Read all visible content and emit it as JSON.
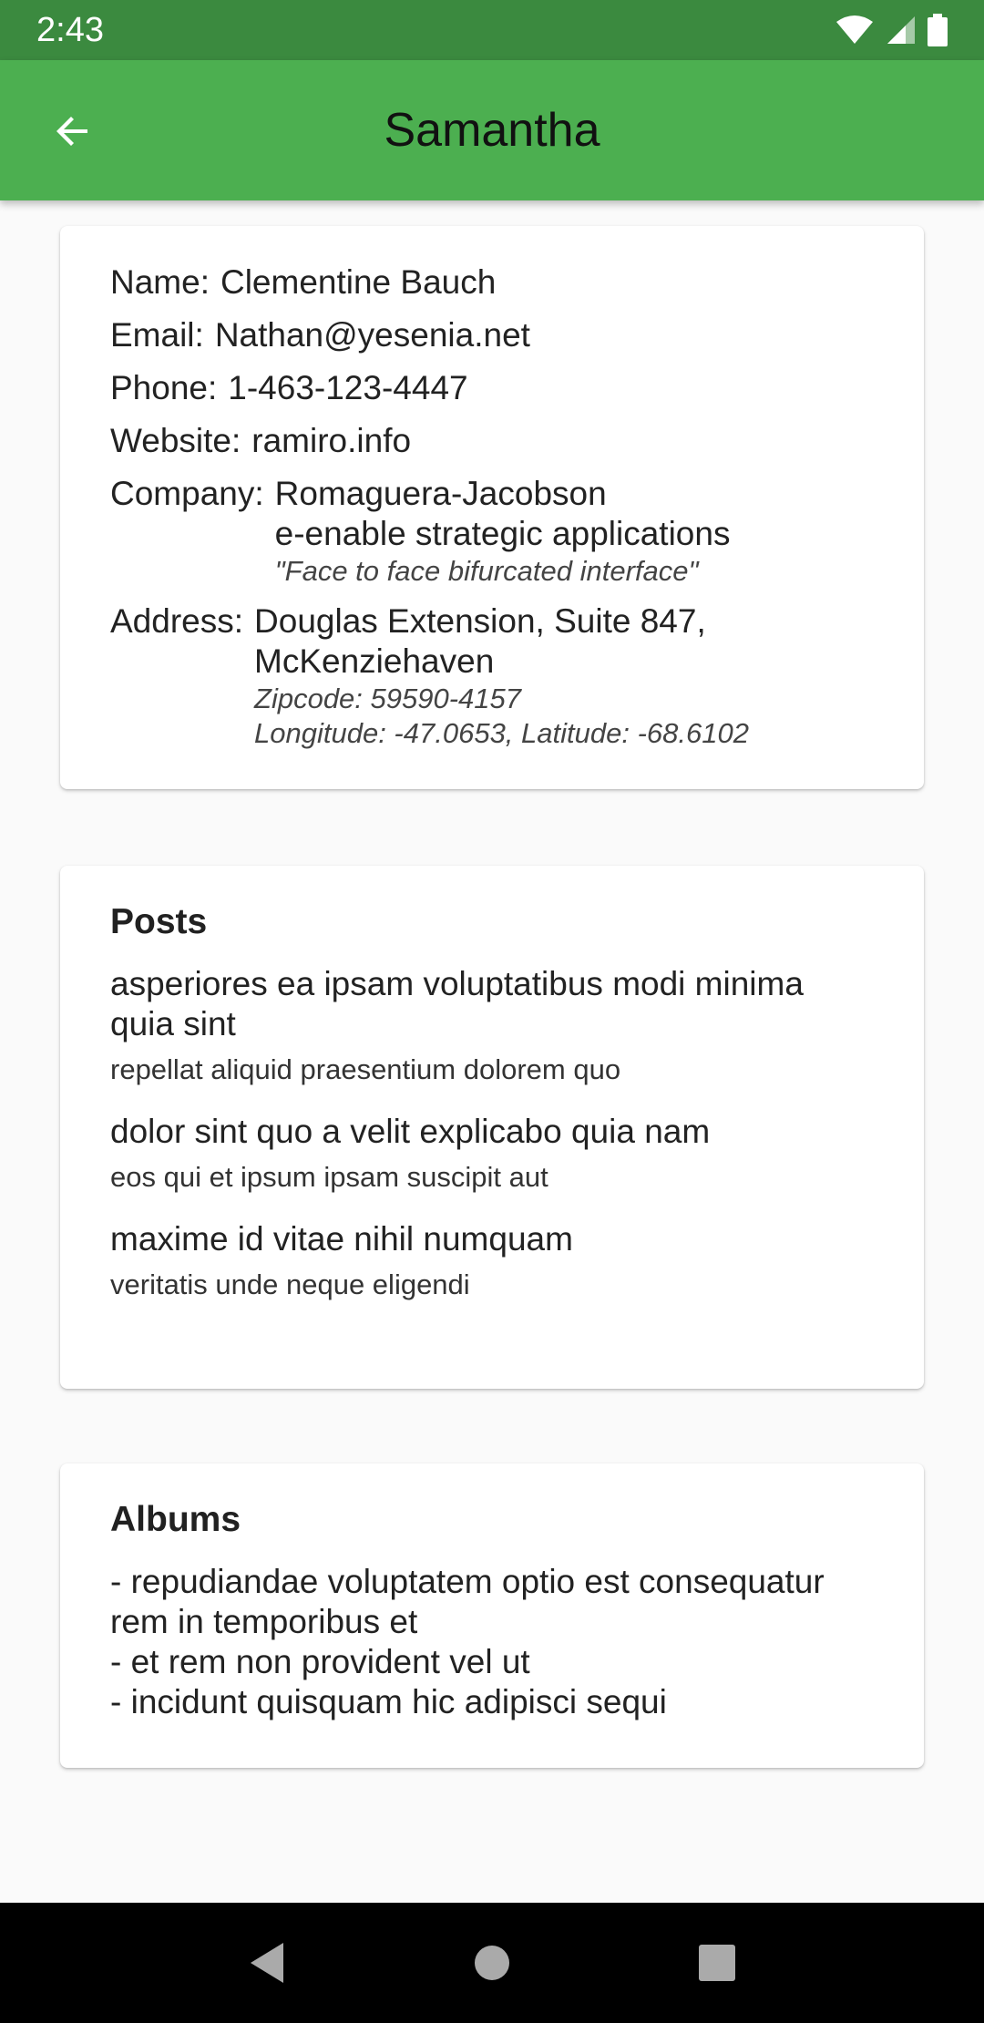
{
  "status_bar": {
    "time": "2:43"
  },
  "app_bar": {
    "title": "Samantha"
  },
  "user": {
    "name_label": "Name:",
    "name": "Clementine Bauch",
    "email_label": "Email:",
    "email": "Nathan@yesenia.net",
    "phone_label": "Phone:",
    "phone": "1-463-123-4447",
    "website_label": "Website:",
    "website": "ramiro.info",
    "company_label": "Company:",
    "company_name": "Romaguera-Jacobson",
    "company_bs": "e-enable strategic applications",
    "company_catchphrase": "\"Face to face bifurcated interface\"",
    "address_label": "Address:",
    "address_street": "Douglas Extension, Suite 847,",
    "address_city": "McKenziehaven",
    "address_zip": "Zipcode: 59590-4157",
    "address_geo": "Longitude: -47.0653, Latitude: -68.6102"
  },
  "posts": {
    "title": "Posts",
    "items": [
      {
        "title": "asperiores ea ipsam voluptatibus modi minima quia sint",
        "body": "repellat aliquid praesentium dolorem quo"
      },
      {
        "title": "dolor sint quo a velit explicabo quia nam",
        "body": "eos qui et ipsum ipsam suscipit aut"
      },
      {
        "title": "maxime id vitae nihil numquam",
        "body": "veritatis unde neque eligendi"
      }
    ]
  },
  "albums": {
    "title": "Albums",
    "items": [
      "- repudiandae voluptatem optio est consequatur rem in temporibus et",
      "- et rem non provident vel ut",
      "- incidunt quisquam hic adipisci sequi"
    ]
  },
  "colors": {
    "status_bar": "#3b8a3f",
    "app_bar": "#4caf50",
    "nav_bar": "#000000"
  },
  "icons": {
    "back": "arrow-left-icon",
    "wifi": "wifi-icon",
    "signal": "cell-signal-icon",
    "battery": "battery-icon",
    "nav_back": "triangle-back-icon",
    "nav_home": "circle-home-icon",
    "nav_recents": "square-recents-icon"
  }
}
